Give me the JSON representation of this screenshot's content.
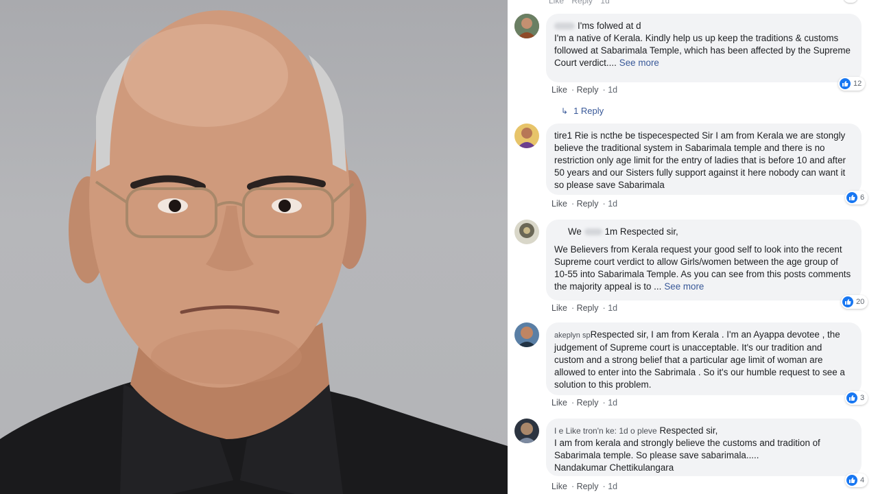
{
  "top_strip": {
    "like": "Like",
    "reply": "Reply",
    "time": "1d"
  },
  "comments": [
    {
      "author": "I'ms folwed at d",
      "text": "I'm a native of Kerala. Kindly help us up keep the traditions & customs followed at Sabarimala Temple, which has been affected by the Supreme Court verdict....",
      "see_more": "See more",
      "like": "Like",
      "reply": "Reply",
      "time": "1d",
      "reactions": "12",
      "reply_count": "1 Reply",
      "avatar_icon": "avatar-photo"
    },
    {
      "author": "tire1 Rie is ncthe be tispe",
      "text": "cespected Sir I am from Kerala we are stongly believe the traditional system in Sabarimala temple and there is no restriction only age limit for the entry of ladies that is before 10 and after 50 years and our Sisters fully support against it here nobody can want it so please save Sabarimala",
      "like": "Like",
      "reply": "Reply",
      "time": "1d",
      "reactions": "6",
      "avatar_icon": "avatar-photo"
    },
    {
      "author": "We",
      "author2": "1m Respected sir,",
      "text": "We Believers from Kerala request your good self to look into the recent Supreme court verdict to allow Girls/women between the age group of 10-55 into Sabarimala Temple. As you can see from this posts comments the majority appeal is to ...",
      "see_more": "See more",
      "like": "Like",
      "reply": "Reply",
      "time": "1d",
      "reactions": "20",
      "avatar_icon": "avatar-photo"
    },
    {
      "author": "akeplyn sp",
      "text": "Respected sir, I am from Kerala . I'm an Ayappa devotee , the judgement of Supreme court is unacceptable. It's our tradition and custom and a strong belief that a particular age limit of woman are allowed to enter into the Sabrimala . So it's our humble request to see a solution to this problem.",
      "like": "Like",
      "reply": "Reply",
      "time": "1d",
      "reactions": "3",
      "avatar_icon": "avatar-photo"
    },
    {
      "author": "I e Like tron'n ke: 1d o pleve",
      "text_line1": "Respected sir,",
      "text": "I am from kerala and strongly believe the customs and tradition of Sabarimala temple. So please save sabarimala.....",
      "signature": "Nandakumar Chettikulangara",
      "like": "Like",
      "reply": "Reply",
      "time": "1d",
      "reactions": "4",
      "avatar_icon": "avatar-photo"
    }
  ],
  "colors": {
    "bubble": "#f2f3f5",
    "link": "#385898",
    "like_blue": "#1877f2",
    "meta": "#606770"
  }
}
